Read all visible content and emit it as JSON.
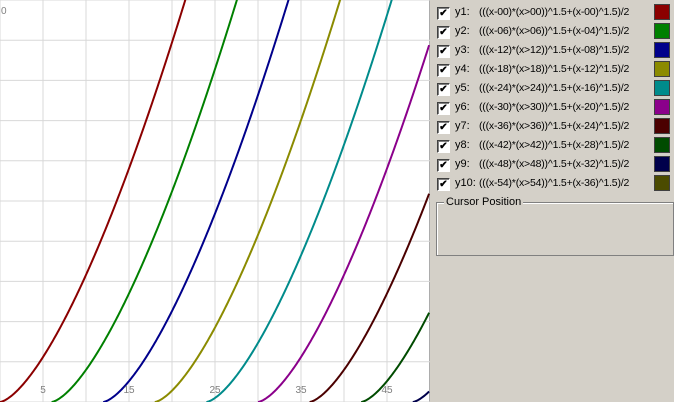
{
  "plot": {
    "x_axis_ticks": [
      "5",
      "15",
      "25",
      "35",
      "45"
    ],
    "y_axis_label_top": "0",
    "x_tick_values": [
      5,
      15,
      25,
      35,
      45
    ],
    "x_range": [
      0,
      50
    ],
    "y_range": [
      0,
      100
    ],
    "x_step": 5,
    "y_step": 10,
    "grid": true
  },
  "legend": {
    "items": [
      {
        "label": "y1:",
        "formula": "(((x-00)*(x>00))^1.5+(x-00)^1.5)/2",
        "color": "#8b0000",
        "checked": true,
        "shift": 0
      },
      {
        "label": "y2:",
        "formula": "(((x-06)*(x>06))^1.5+(x-04)^1.5)/2",
        "color": "#008000",
        "checked": true,
        "shift": 6
      },
      {
        "label": "y3:",
        "formula": "(((x-12)*(x>12))^1.5+(x-08)^1.5)/2",
        "color": "#00008b",
        "checked": true,
        "shift": 12
      },
      {
        "label": "y4:",
        "formula": "(((x-18)*(x>18))^1.5+(x-12)^1.5)/2",
        "color": "#8b8b00",
        "checked": true,
        "shift": 18
      },
      {
        "label": "y5:",
        "formula": "(((x-24)*(x>24))^1.5+(x-16)^1.5)/2",
        "color": "#008b8b",
        "checked": true,
        "shift": 24
      },
      {
        "label": "y6:",
        "formula": "(((x-30)*(x>30))^1.5+(x-20)^1.5)/2",
        "color": "#8b008b",
        "checked": true,
        "shift": 30
      },
      {
        "label": "y7:",
        "formula": "(((x-36)*(x>36))^1.5+(x-24)^1.5)/2",
        "color": "#4b0000",
        "checked": true,
        "shift": 36
      },
      {
        "label": "y8:",
        "formula": "(((x-42)*(x>42))^1.5+(x-28)^1.5)/2",
        "color": "#004b00",
        "checked": true,
        "shift": 42
      },
      {
        "label": "y9:",
        "formula": "(((x-48)*(x>48))^1.5+(x-32)^1.5)/2",
        "color": "#00004b",
        "checked": true,
        "shift": 48
      },
      {
        "label": "y10:",
        "formula": "(((x-54)*(x>54))^1.5+(x-36)^1.5)/2",
        "color": "#4b4b00",
        "checked": true,
        "shift": 54
      }
    ]
  },
  "cursor_panel": {
    "title": "Cursor Position",
    "value": ""
  }
}
